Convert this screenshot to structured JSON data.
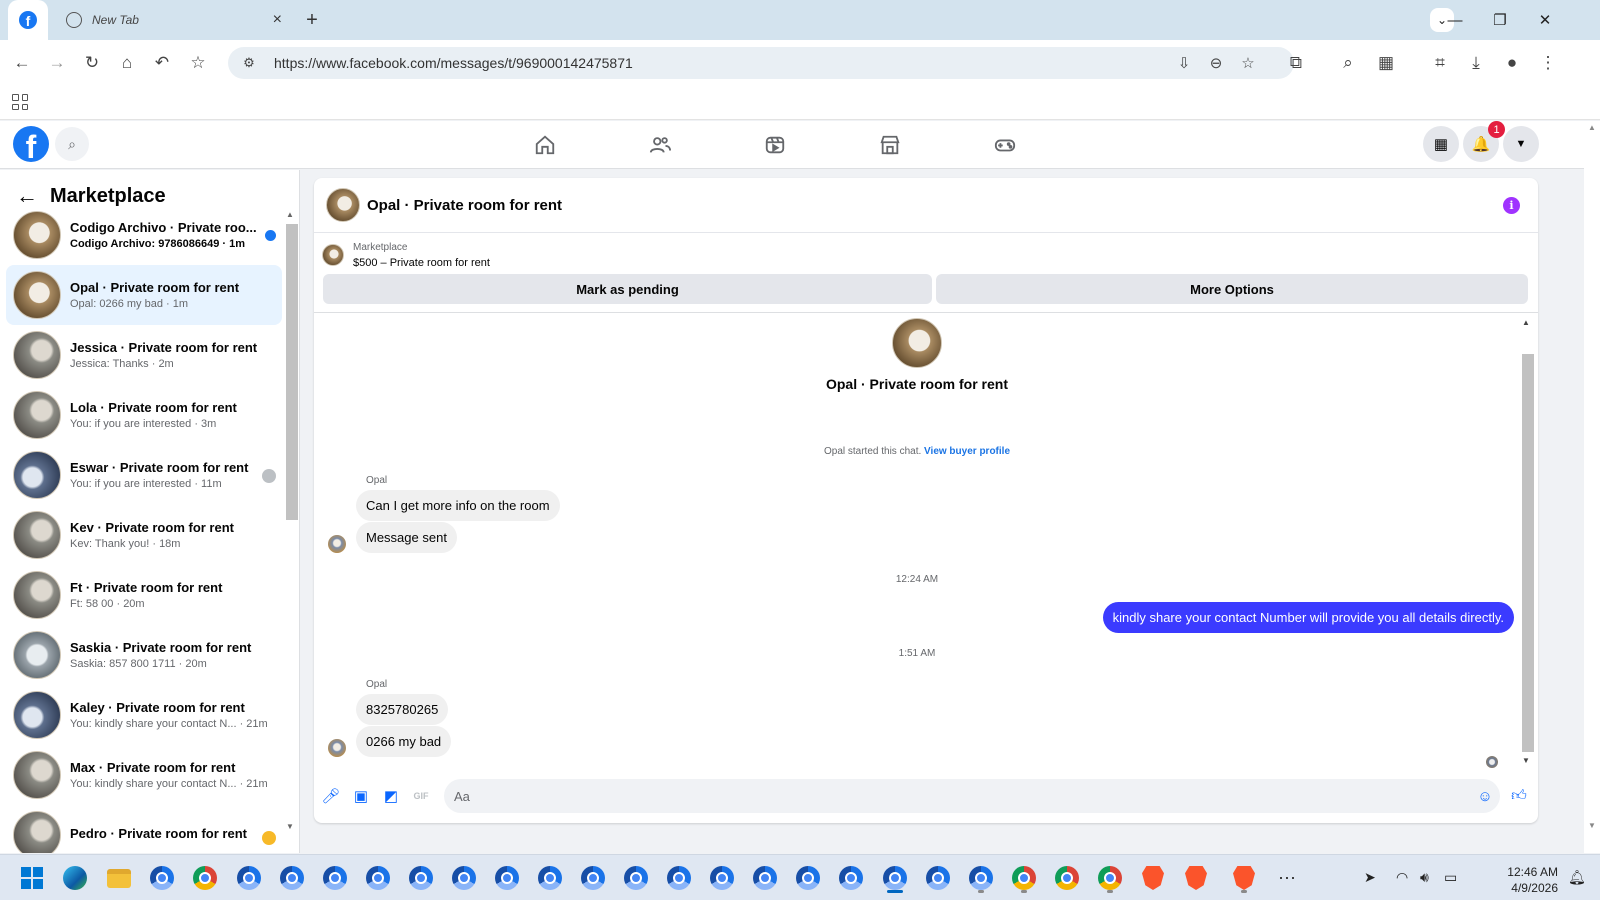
{
  "browser": {
    "active_tab_icon": "facebook-favicon",
    "inactive_tab_title": "New Tab",
    "url": "https://www.facebook.com/messages/t/969000142475871"
  },
  "facebook": {
    "logo_letter": "f",
    "notification_count": "1"
  },
  "sidebar": {
    "title": "Marketplace",
    "conversations": [
      {
        "title": "Codigo Archivo · Private roo...",
        "subtitle": "Codigo Archivo: 9786086649 · 1m",
        "unread": true
      },
      {
        "title": "Opal · Private room for rent",
        "subtitle": "Opal: 0266 my bad · 1m",
        "selected": true
      },
      {
        "title": "Jessica · Private room for rent",
        "subtitle": "Jessica: Thanks · 2m"
      },
      {
        "title": "Lola · Private room for rent",
        "subtitle": "You: if you are interested · 3m"
      },
      {
        "title": "Eswar · Private room for rent",
        "subtitle": "You: if you are interested · 11m"
      },
      {
        "title": "Kev · Private room for rent",
        "subtitle": "Kev: Thank you! · 18m"
      },
      {
        "title": "Ft · Private room for rent",
        "subtitle": "Ft: 58 00 · 20m"
      },
      {
        "title": "Saskia · Private room for rent",
        "subtitle": "Saskia: 857 800 1711 · 20m"
      },
      {
        "title": "Kaley · Private room for rent",
        "subtitle": "You: kindly share your contact N... · 21m"
      },
      {
        "title": "Max · Private room for rent",
        "subtitle": "You: kindly share your contact N... · 21m"
      },
      {
        "title": "Pedro · Private room for rent",
        "subtitle": ""
      }
    ]
  },
  "chat": {
    "title": "Opal · Private room for rent",
    "listing_category": "Marketplace",
    "listing_price": "$500 – Private room for rent",
    "mark_pending_label": "Mark as pending",
    "more_options_label": "More Options",
    "thread_title": "Opal · Private room for rent",
    "started_text": "Opal started this chat.",
    "view_profile_link": "View buyer profile",
    "sender_name_1": "Opal",
    "msg_1": "Can I get more info on the room",
    "msg_2": "Message sent",
    "timestamp_1": "12:24 AM",
    "msg_out": "kindly share your contact Number will provide you all details directly.",
    "timestamp_2": "1:51 AM",
    "sender_name_2": "Opal",
    "msg_3": "8325780265",
    "msg_4": "0266 my bad",
    "composer_placeholder": "Aa",
    "out_bubble_color": "#3b3bff"
  },
  "taskbar": {
    "time": "12:46 AM",
    "date": "4/9/2026"
  }
}
